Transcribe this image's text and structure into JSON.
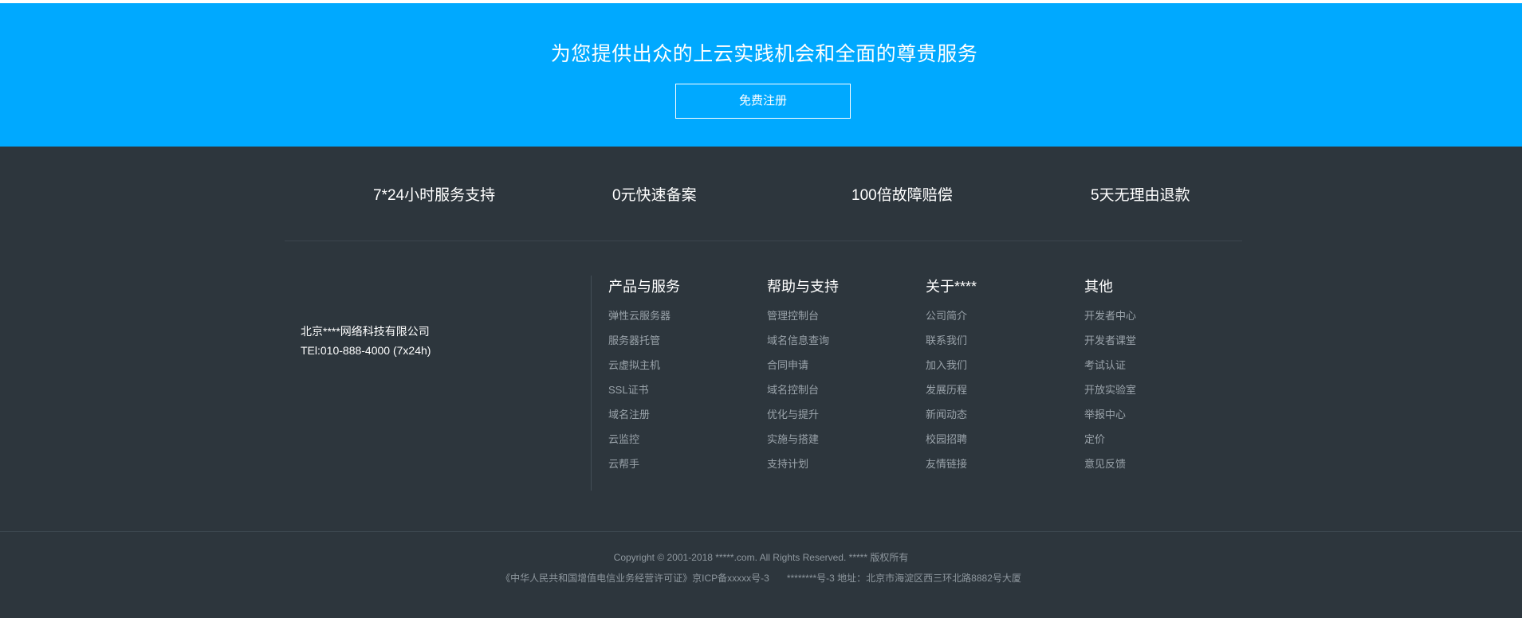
{
  "banner": {
    "title": "为您提供出众的上云实践机会和全面的尊贵服务",
    "button_label": "免费注册"
  },
  "features": [
    "7*24小时服务支持",
    "0元快速备案",
    "100倍故障赔偿",
    "5天无理由退款"
  ],
  "company": {
    "name": "北京****网络科技有限公司",
    "tel": "TEl:010-888-4000 (7x24h)"
  },
  "columns": [
    {
      "title": "产品与服务",
      "links": [
        "弹性云服务器",
        "服务器托管",
        "云虚拟主机",
        "SSL证书",
        "域名注册",
        "云监控",
        "云帮手"
      ]
    },
    {
      "title": "帮助与支持",
      "links": [
        "管理控制台",
        "域名信息查询",
        "合同申请",
        "域名控制台",
        "优化与提升",
        "实施与搭建",
        "支持计划"
      ]
    },
    {
      "title": "关于****",
      "links": [
        "公司简介",
        "联系我们",
        "加入我们",
        "发展历程",
        "新闻动态",
        "校园招聘",
        "友情链接"
      ]
    },
    {
      "title": "其他",
      "links": [
        "开发者中心",
        "开发者课堂",
        "考试认证",
        "开放实验室",
        "举报中心",
        "定价",
        "意见反馈"
      ]
    }
  ],
  "legal": {
    "copyright": "Copyright © 2001-2018 *****.com. All Rights Reserved. ***** 版权所有",
    "icp_license": "《中华人民共和国增值电信业务经营许可证》京ICP备xxxxx号-3",
    "icp_address": "********号-3 地址：北京市海淀区西三环北路8882号大厦"
  },
  "colors": {
    "banner_bg": "#00a9ff",
    "footer_bg": "#2d363d",
    "link_text": "#9aa3aa"
  }
}
